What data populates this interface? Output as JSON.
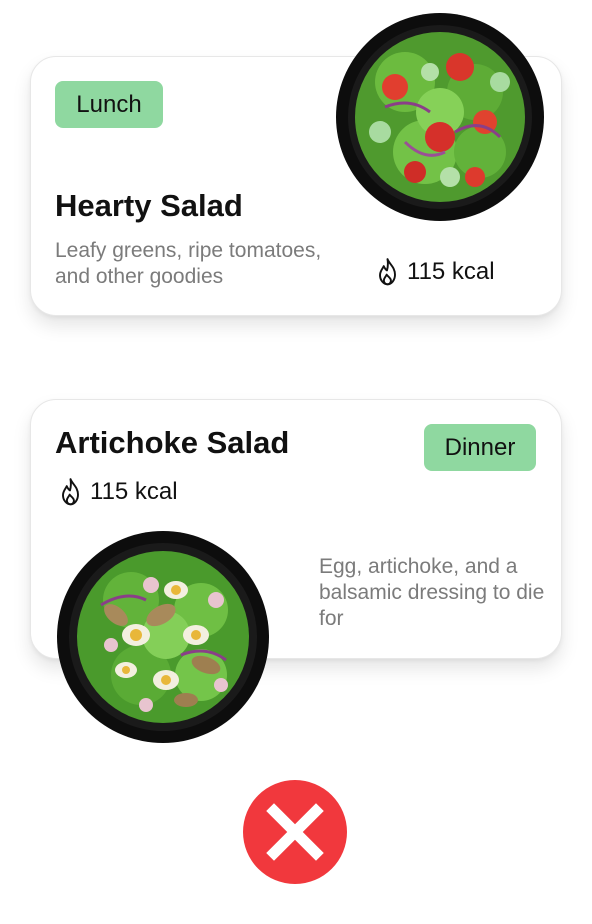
{
  "cards": [
    {
      "tag": "Lunch",
      "title": "Hearty Salad",
      "description": "Leafy greens, ripe tomatoes, and other goodies",
      "calories": "115 kcal",
      "calorie_icon": "flame-icon",
      "image": "salad-bowl-tomato"
    },
    {
      "tag": "Dinner",
      "title": "Artichoke Salad",
      "description": "Egg, artichoke, and a balsamic dressing to die for",
      "calories": "115 kcal",
      "calorie_icon": "flame-icon",
      "image": "salad-bowl-egg-artichoke"
    }
  ],
  "close_button": {
    "icon": "close-icon"
  },
  "colors": {
    "tag_background": "#8fd8a0",
    "description_text": "#7b7b7b",
    "close_button": "#f1383d"
  }
}
